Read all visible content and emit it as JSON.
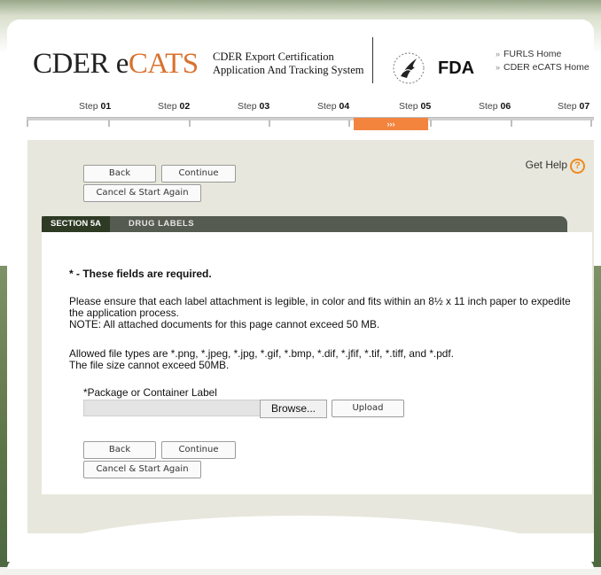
{
  "header": {
    "logo_prefix": "CDER e",
    "logo_suffix": "CATS",
    "system_line1": "CDER Export Certification",
    "system_line2": "Application And Tracking System",
    "hhs_icon": "hhs-eagle-icon",
    "fda_logo_text": "FDA",
    "links": [
      "FURLS Home",
      "CDER eCATS Home"
    ],
    "link_chevron": "»"
  },
  "steps": {
    "prefix": "Step",
    "numbers": [
      "01",
      "02",
      "03",
      "04",
      "05",
      "06",
      "07"
    ],
    "active_index": 4,
    "active_marker": "›››"
  },
  "help": {
    "label": "Get Help",
    "icon": "?"
  },
  "nav": {
    "back": "Back",
    "continue": "Continue",
    "cancel": "Cancel & Start Again"
  },
  "section": {
    "number": "SECTION 5A",
    "title": "DRUG LABELS"
  },
  "instructions": {
    "required": "* - These fields are required.",
    "line1": "Please ensure that each label attachment is legible, in color and fits within an 8½ x 11 inch paper to expedite",
    "line2": "the application process.",
    "line3": "NOTE: All attached documents for this page cannot exceed 50 MB.",
    "line4": "Allowed file types are *.png, *.jpeg, *.jpg, *.gif, *.bmp, *.dif, *.jfif, *.tif, *.tiff, and *.pdf.",
    "line5": "The file size cannot exceed 50MB."
  },
  "upload": {
    "label": "*Package or Container Label",
    "file_value": "",
    "browse": "Browse...",
    "upload": "Upload"
  },
  "colors": {
    "accent_orange": "#f3843e",
    "section_bar": "#555b50",
    "content_bg": "#e7e7dd",
    "green_band": "#5e7548"
  }
}
